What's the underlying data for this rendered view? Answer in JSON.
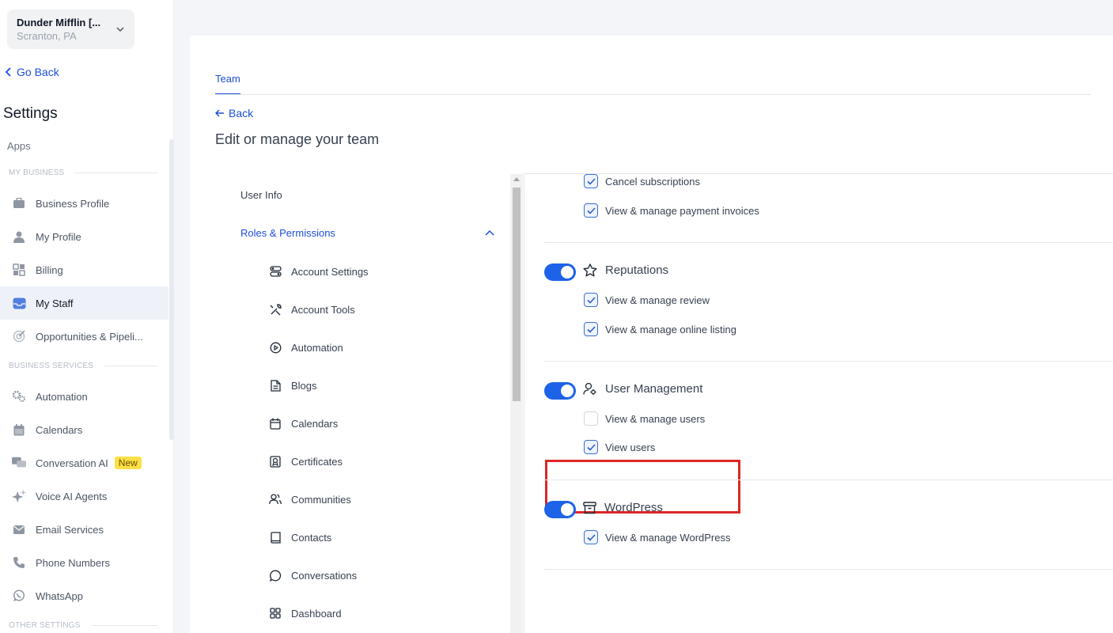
{
  "account": {
    "name": "Dunder Mifflin [...",
    "location": "Scranton, PA"
  },
  "sidebar": {
    "go_back": "Go Back",
    "title": "Settings",
    "apps": "Apps",
    "sections": {
      "my_business": "MY BUSINESS",
      "business_services": "BUSINESS SERVICES",
      "other_settings": "OTHER SETTINGS"
    },
    "items": [
      {
        "label": "Business Profile",
        "icon": "briefcase-icon"
      },
      {
        "label": "My Profile",
        "icon": "user-icon"
      },
      {
        "label": "Billing",
        "icon": "billing-icon"
      },
      {
        "label": "My Staff",
        "icon": "staff-icon",
        "active": true
      },
      {
        "label": "Opportunities & Pipeli...",
        "icon": "target-icon"
      },
      {
        "label": "Automation",
        "icon": "gears-icon"
      },
      {
        "label": "Calendars",
        "icon": "calendar-icon"
      },
      {
        "label": "Conversation AI",
        "icon": "chat-icon",
        "badge": "New"
      },
      {
        "label": "Voice AI Agents",
        "icon": "sparkle-icon"
      },
      {
        "label": "Email Services",
        "icon": "mail-icon"
      },
      {
        "label": "Phone Numbers",
        "icon": "phone-icon"
      },
      {
        "label": "WhatsApp",
        "icon": "whatsapp-icon"
      }
    ]
  },
  "main": {
    "tab": "Team",
    "back": "Back",
    "title": "Edit or manage your team",
    "subnav": {
      "user_info": "User Info",
      "roles": "Roles & Permissions",
      "items": [
        "Account Settings",
        "Account Tools",
        "Automation",
        "Blogs",
        "Calendars",
        "Certificates",
        "Communities",
        "Contacts",
        "Conversations",
        "Dashboard"
      ]
    },
    "permissions": {
      "payments": {
        "items": [
          {
            "label": "Cancel subscriptions",
            "checked": true
          },
          {
            "label": "View & manage payment invoices",
            "checked": true
          }
        ]
      },
      "reputations": {
        "title": "Reputations",
        "enabled": true,
        "items": [
          {
            "label": "View & manage review",
            "checked": true
          },
          {
            "label": "View & manage online listing",
            "checked": true
          }
        ]
      },
      "user_management": {
        "title": "User Management",
        "enabled": true,
        "items": [
          {
            "label": "View & manage users",
            "checked": false
          },
          {
            "label": "View users",
            "checked": true
          }
        ]
      },
      "wordpress": {
        "title": "WordPress",
        "enabled": true,
        "items": [
          {
            "label": "View & manage WordPress",
            "checked": true
          }
        ]
      }
    }
  },
  "colors": {
    "accent": "#1d63e8",
    "highlight": "#dc2626",
    "badge": "#fde047"
  }
}
